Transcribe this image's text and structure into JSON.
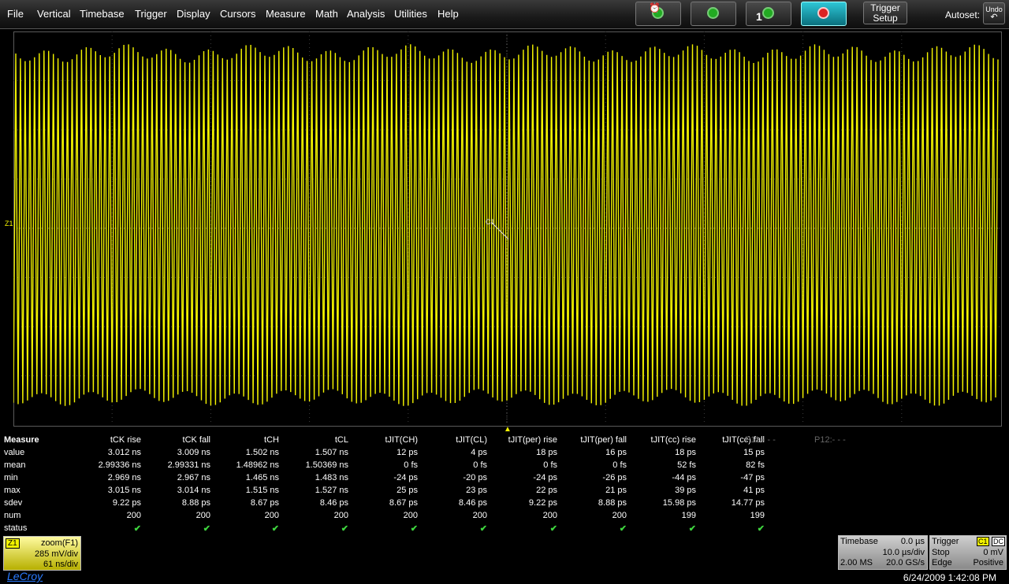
{
  "menu": [
    "File",
    "Vertical",
    "Timebase",
    "Trigger",
    "Display",
    "Cursors",
    "Measure",
    "Math",
    "Analysis",
    "Utilities",
    "Help"
  ],
  "toolbar": {
    "trigger_setup_line1": "Trigger",
    "trigger_setup_line2": "Setup",
    "autoset_label": "Autoset:",
    "undo_label": "Undo",
    "single_badge": "1"
  },
  "trace": {
    "color": "#f2f200",
    "label": "Z1",
    "marker": "C1"
  },
  "measure": {
    "title": "Measure",
    "columns": [
      "tCK rise",
      "tCK fall",
      "tCH",
      "tCL",
      "tJIT(CH)",
      "tJIT(CL)",
      "tJIT(per) rise",
      "tJIT(per) fall",
      "tJIT(cc) rise",
      "tJIT(cc) fall",
      "P11:- - -",
      "P12:- - -"
    ],
    "row_labels": [
      "value",
      "mean",
      "min",
      "max",
      "sdev",
      "num",
      "status"
    ],
    "rows": [
      [
        "3.012 ns",
        "3.009 ns",
        "1.502 ns",
        "1.507 ns",
        "12 ps",
        "4 ps",
        "18 ps",
        "16 ps",
        "18 ps",
        "15 ps"
      ],
      [
        "2.99336 ns",
        "2.99331 ns",
        "1.48962 ns",
        "1.50369 ns",
        "0 fs",
        "0 fs",
        "0 fs",
        "0 fs",
        "52 fs",
        "82 fs"
      ],
      [
        "2.969 ns",
        "2.967 ns",
        "1.465 ns",
        "1.483 ns",
        "-24 ps",
        "-20 ps",
        "-24 ps",
        "-26 ps",
        "-44 ps",
        "-47 ps"
      ],
      [
        "3.015 ns",
        "3.014 ns",
        "1.515 ns",
        "1.527 ns",
        "25 ps",
        "23 ps",
        "22 ps",
        "21 ps",
        "39 ps",
        "41 ps"
      ],
      [
        "9.22 ps",
        "8.88 ps",
        "8.67 ps",
        "8.46 ps",
        "8.67 ps",
        "8.46 ps",
        "9.22 ps",
        "8.88 ps",
        "15.98 ps",
        "14.77 ps"
      ],
      [
        "200",
        "200",
        "200",
        "200",
        "200",
        "200",
        "200",
        "200",
        "199",
        "199"
      ],
      [
        "✔",
        "✔",
        "✔",
        "✔",
        "✔",
        "✔",
        "✔",
        "✔",
        "✔",
        "✔"
      ]
    ]
  },
  "zoom": {
    "tag": "Z1",
    "name": "zoom(F1)",
    "vdiv": "285 mV/div",
    "tdiv": "61 ns/div"
  },
  "timebase": {
    "label": "Timebase",
    "delay": "0.0 µs",
    "tdiv": "10.0 µs/div",
    "samples": "2.00 MS",
    "rate": "20.0 GS/s"
  },
  "trigger": {
    "label": "Trigger",
    "channel": "C1",
    "coupling": "DC",
    "mode": "Stop",
    "level": "0 mV",
    "type": "Edge",
    "slope": "Positive"
  },
  "brand": "LeCroy",
  "datetime": "6/24/2009 1:42:08 PM"
}
